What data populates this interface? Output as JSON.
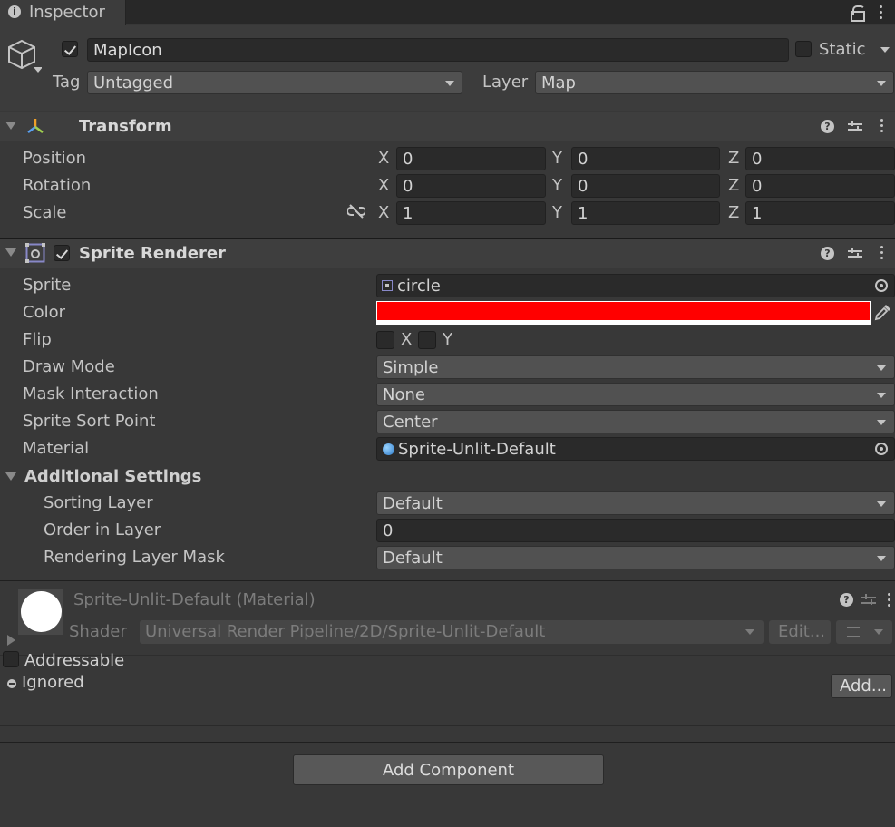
{
  "window": {
    "tab_title": "Inspector"
  },
  "object": {
    "name": "MapIcon",
    "static_label": "Static",
    "tag_label": "Tag",
    "tag_value": "Untagged",
    "layer_label": "Layer",
    "layer_value": "Map"
  },
  "transform": {
    "title": "Transform",
    "rows": [
      {
        "label": "Position",
        "x": "0",
        "y": "0",
        "z": "0"
      },
      {
        "label": "Rotation",
        "x": "0",
        "y": "0",
        "z": "0"
      },
      {
        "label": "Scale",
        "x": "1",
        "y": "1",
        "z": "1"
      }
    ],
    "axis_x": "X",
    "axis_y": "Y",
    "axis_z": "Z"
  },
  "sprite_renderer": {
    "title": "Sprite Renderer",
    "sprite_label": "Sprite",
    "sprite_value": "circle",
    "color_label": "Color",
    "color_value": "#ff0000",
    "flip_label": "Flip",
    "flip_x": "X",
    "flip_y": "Y",
    "draw_mode_label": "Draw Mode",
    "draw_mode_value": "Simple",
    "mask_label": "Mask Interaction",
    "mask_value": "None",
    "sort_point_label": "Sprite Sort Point",
    "sort_point_value": "Center",
    "material_label": "Material",
    "material_value": "Sprite-Unlit-Default",
    "additional_title": "Additional Settings",
    "sorting_layer_label": "Sorting Layer",
    "sorting_layer_value": "Default",
    "order_label": "Order in Layer",
    "order_value": "0",
    "rendering_mask_label": "Rendering Layer Mask",
    "rendering_mask_value": "Default"
  },
  "material": {
    "title": "Sprite-Unlit-Default (Material)",
    "shader_label": "Shader",
    "shader_value": "Universal Render Pipeline/2D/Sprite-Unlit-Default",
    "edit_label": "Edit..."
  },
  "addressable": {
    "label": "Addressable",
    "ignored_label": "Ignored",
    "add_label": "Add..."
  },
  "footer": {
    "add_component_label": "Add Component"
  }
}
